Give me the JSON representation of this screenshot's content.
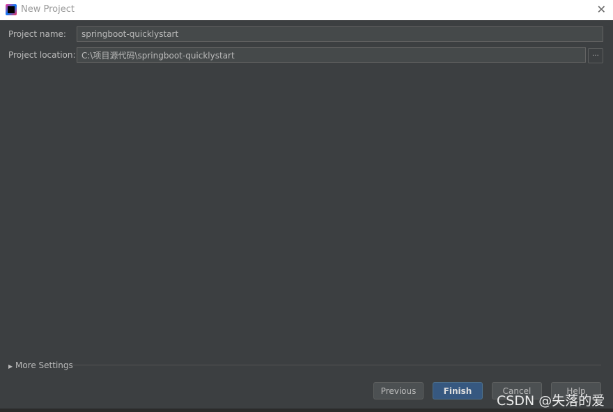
{
  "window": {
    "title": "New Project",
    "close_icon": "close-icon"
  },
  "form": {
    "name_label": "Project name:",
    "name_value": "springboot-quicklystart",
    "location_label": "Project location:",
    "location_value": "C:\\项目源代码\\springboot-quicklystart",
    "browse_label": "..."
  },
  "more_settings": {
    "label": "More Settings"
  },
  "buttons": {
    "previous": "Previous",
    "finish": "Finish",
    "cancel": "Cancel",
    "help": "Help"
  },
  "watermark": "CSDN @失落的爱"
}
